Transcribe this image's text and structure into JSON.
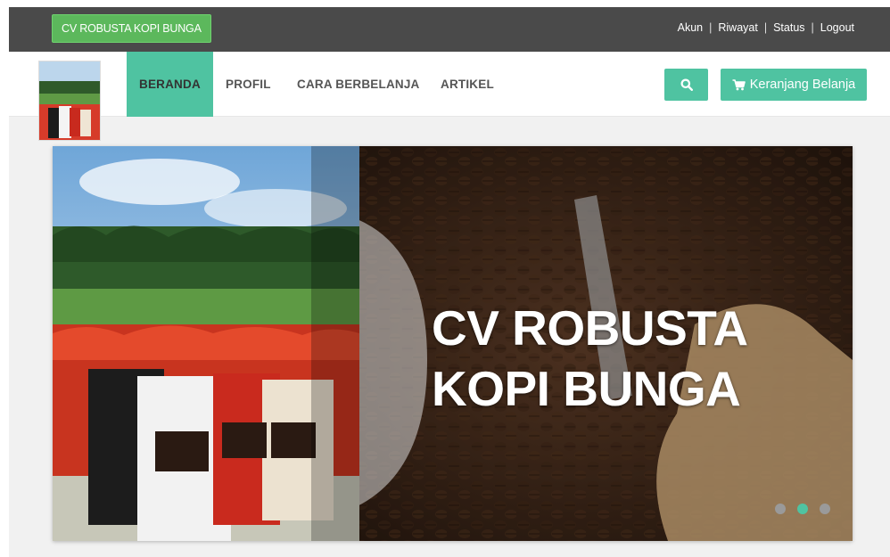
{
  "topbar": {
    "brand": "CV ROBUSTA KOPI BUNGA",
    "links": [
      "Akun",
      "Riwayat",
      "Status",
      "Logout"
    ],
    "separator": "|"
  },
  "nav": {
    "items": [
      "BERANDA",
      "PROFIL",
      "CARA BERBELANJA",
      "ARTIKEL"
    ],
    "active": "BERANDA",
    "cart_label": "Keranjang Belanja"
  },
  "slider": {
    "title_line1": "CV ROBUSTA",
    "title_line2": "KOPI BUNGA",
    "slide_count": 3,
    "active_slide": 2
  },
  "colors": {
    "accent": "#4fc3a1",
    "topbar": "#4a4a4a",
    "brand_button": "#5cb85c"
  },
  "icons": [
    "search-icon",
    "shopping-cart-icon"
  ]
}
